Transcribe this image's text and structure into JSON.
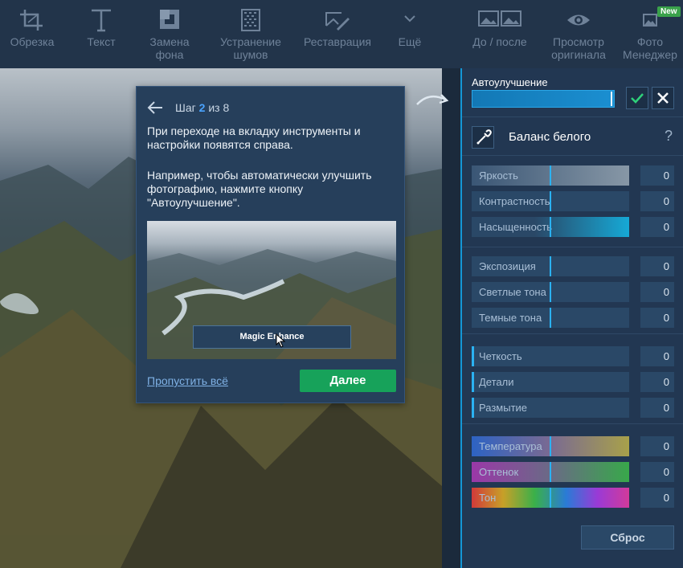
{
  "toolbar": {
    "items": [
      {
        "label": "Обрезка",
        "icon": "crop-icon"
      },
      {
        "label": "Текст",
        "icon": "text-icon"
      },
      {
        "label": "Замена\nфона",
        "icon": "background-icon"
      },
      {
        "label": "Устранение\nшумов",
        "icon": "denoise-icon"
      },
      {
        "label": "Реставрация",
        "icon": "restore-icon"
      },
      {
        "label": "Ещё",
        "icon": "chevron-down-icon"
      },
      {
        "label": "До / после",
        "icon": "before-after-icon"
      },
      {
        "label": "Просмотр\nоригинала",
        "icon": "eye-icon"
      },
      {
        "label": "Фото\nМенеджер",
        "icon": "photo-manager-icon"
      }
    ],
    "new_badge": "New"
  },
  "tour": {
    "step_prefix": "Шаг",
    "step_current": "2",
    "step_suffix": "из 8",
    "text1": "При переходе на вкладку инструменты и настройки появятся справа.",
    "text2": "Например, чтобы автоматически улучшить фотографию, нажмите кнопку \"Автоулучшение\".",
    "preview_button": "Magic Enhance",
    "skip_label": "Пропустить всё",
    "next_label": "Далее"
  },
  "panel": {
    "auto_label": "Автоулучшение",
    "white_balance_label": "Баланс белого",
    "help": "?",
    "sliders": [
      {
        "label": "Яркость",
        "value": "0"
      },
      {
        "label": "Контрастность",
        "value": "0"
      },
      {
        "label": "Насыщенность",
        "value": "0"
      },
      {
        "label": "Экспозиция",
        "value": "0"
      },
      {
        "label": "Светлые тона",
        "value": "0"
      },
      {
        "label": "Темные тона",
        "value": "0"
      },
      {
        "label": "Четкость",
        "value": "0"
      },
      {
        "label": "Детали",
        "value": "0"
      },
      {
        "label": "Размытие",
        "value": "0"
      },
      {
        "label": "Температура",
        "value": "0"
      },
      {
        "label": "Оттенок",
        "value": "0"
      },
      {
        "label": "Тон",
        "value": "0"
      }
    ],
    "reset_label": "Сброс"
  },
  "colors": {
    "accent": "#1497d6",
    "next_green": "#17a25a",
    "panel_bg": "#223752"
  }
}
